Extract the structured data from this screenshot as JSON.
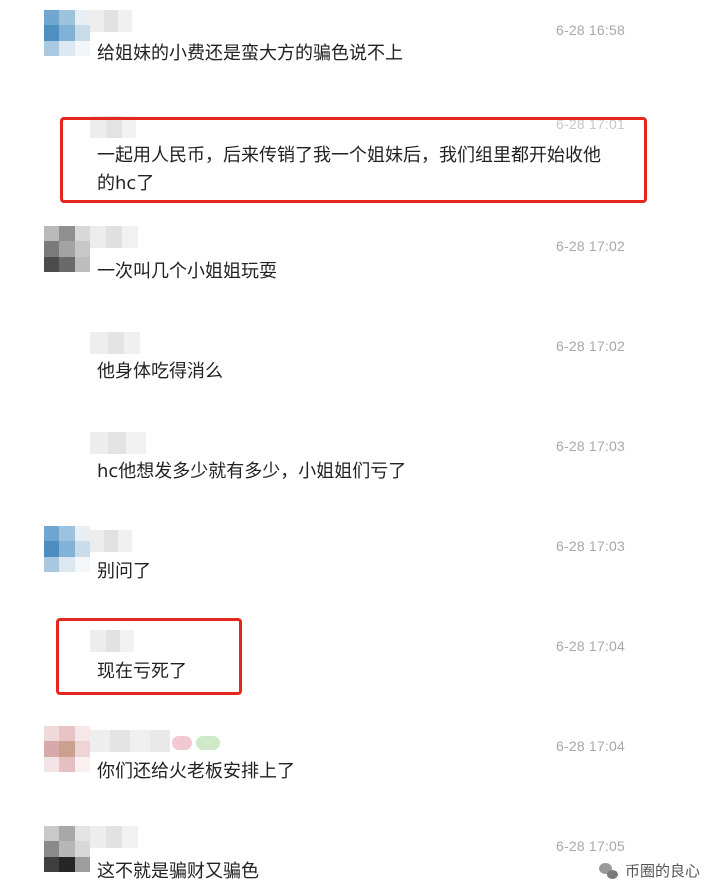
{
  "comments": [
    {
      "time": "6-28 16:58",
      "text": "给姐妹的小费还是蛮大方的骗色说不上"
    },
    {
      "time": "6-28 17:01",
      "text": "一起用人民币，后来传销了我一个姐妹后，我们组里都开始收他的hc了"
    },
    {
      "time": "6-28 17:02",
      "text": "一次叫几个小姐姐玩耍"
    },
    {
      "time": "6-28 17:02",
      "text": "他身体吃得消么"
    },
    {
      "time": "6-28 17:03",
      "text": "hc他想发多少就有多少，小姐姐们亏了"
    },
    {
      "time": "6-28 17:03",
      "text": "别问了"
    },
    {
      "time": "6-28 17:04",
      "text": "现在亏死了"
    },
    {
      "time": "6-28 17:04",
      "text": "你们还给火老板安排上了"
    },
    {
      "time": "6-28 17:05",
      "text": "这不就是骗财又骗色"
    }
  ],
  "watermark": {
    "text": "币圈的良心",
    "icon": "wechat-icon"
  },
  "colors": {
    "highlight": "#e4261c",
    "time": "#a8a8a8",
    "text": "#222222"
  }
}
